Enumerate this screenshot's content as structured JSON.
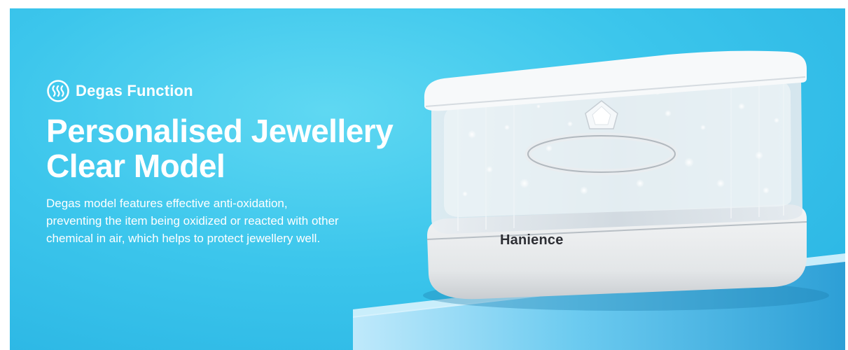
{
  "banner": {
    "feature": {
      "icon": "steam-waves-icon",
      "label": "Degas Function"
    },
    "headline": {
      "line1": "Personalised Jewellery",
      "line2": "Clear Model"
    },
    "description": "Degas model features effective anti-oxidation, preventing the item being oxidized or reacted with other chemical in air, which helps to protect jewellery well.",
    "product": {
      "brand": "Hanience"
    },
    "colors": {
      "background": "#3cc6ec",
      "text": "#ffffff",
      "brand_text": "#2e2f35"
    }
  }
}
